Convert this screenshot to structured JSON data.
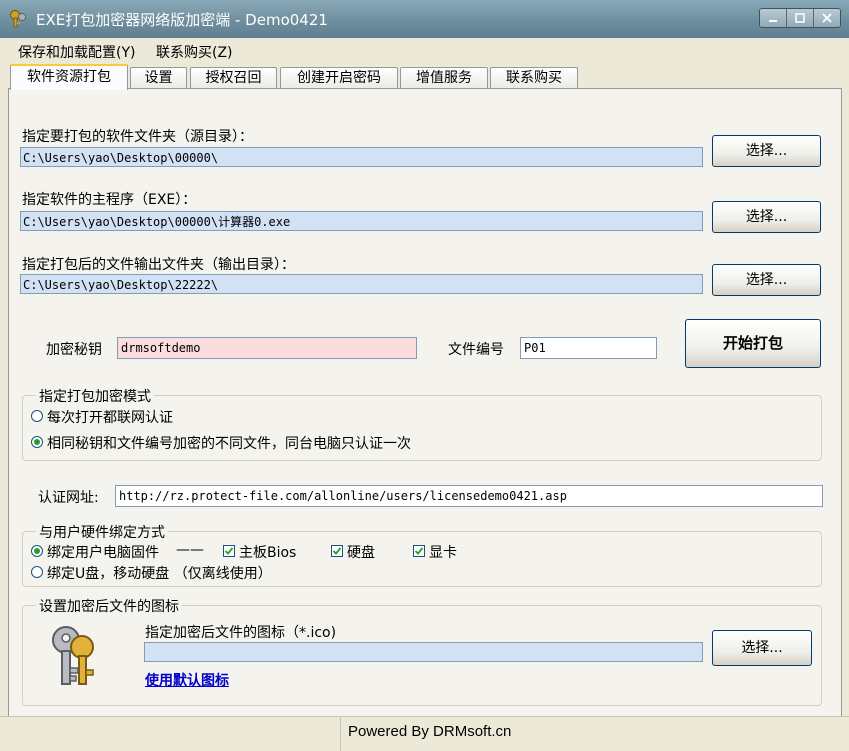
{
  "window": {
    "title": "EXE打包加密器网络版加密端 - Demo0421"
  },
  "menu": {
    "items": [
      "保存和加载配置(Y)",
      "联系购买(Z)"
    ]
  },
  "tabs": [
    "软件资源打包",
    "设置",
    "授权召回",
    "创建开启密码",
    "增值服务",
    "联系购买"
  ],
  "source": {
    "label": "指定要打包的软件文件夹（源目录）：",
    "value": "C:\\Users\\yao\\Desktop\\00000\\",
    "button": "选择..."
  },
  "main_exe": {
    "label": "指定软件的主程序（EXE）：",
    "value": "C:\\Users\\yao\\Desktop\\00000\\计算器0.exe",
    "button": "选择..."
  },
  "output": {
    "label": "指定打包后的文件输出文件夹（输出目录）：",
    "value": "C:\\Users\\yao\\Desktop\\22222\\",
    "button": "选择..."
  },
  "encrypt_key": {
    "label": "加密秘钥",
    "value": "drmsoftdemo"
  },
  "file_number": {
    "label": "文件编号",
    "value": "P01"
  },
  "start_button": "开始打包",
  "mode_group": {
    "title": "指定打包加密模式",
    "options": [
      {
        "label": "每次打开都联网认证",
        "selected": false
      },
      {
        "label": "相同秘钥和文件编号加密的不同文件，同台电脑只认证一次",
        "selected": true
      }
    ]
  },
  "auth_url": {
    "label": "认证网址:",
    "value": "http://rz.protect-file.com/allonline/users/licensedemo0421.asp"
  },
  "hardware_group": {
    "title": "与用户硬件绑定方式",
    "option1": "绑定用户电脑固件",
    "dash": "——",
    "checks": [
      "主板Bios",
      "硬盘",
      "显卡"
    ],
    "option2": "绑定U盘，移动硬盘 （仅离线使用）"
  },
  "icon_group": {
    "title": "设置加密后文件的图标",
    "label": "指定加密后文件的图标（*.ico)",
    "value": "",
    "button": "选择...",
    "default_link": "使用默认图标"
  },
  "status": {
    "text": "Powered By DRMsoft.cn"
  },
  "icons": {
    "app": "keys-icon",
    "group": "keys-icon"
  },
  "colors": {
    "titlebar": "#6f8f9f",
    "path_field": "#d2e1f3",
    "key_field": "#fadcdc",
    "link": "#0000cc",
    "tab_highlight": "#ffc83c"
  }
}
